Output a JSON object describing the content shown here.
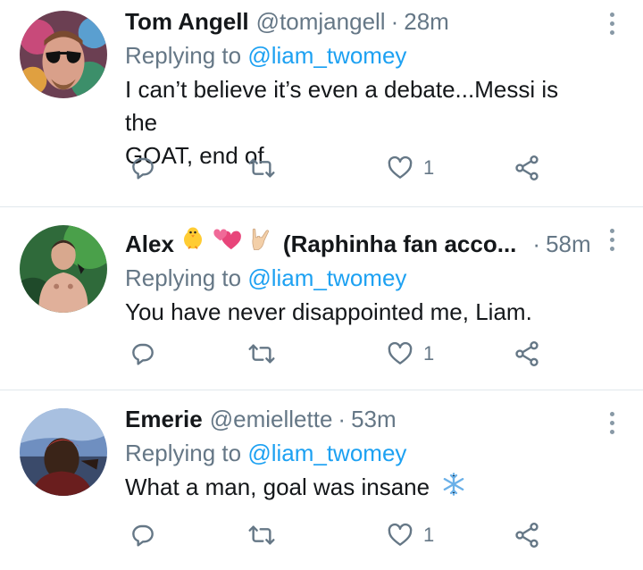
{
  "tweets": [
    {
      "name": "Tom Angell",
      "handle": "@tomjangell",
      "separator": "·",
      "time": "28m",
      "replying_prefix": "Replying to ",
      "replying_to": "@liam_twomey",
      "text_line1": "I can’t believe it’s even a debate...Messi is the",
      "text_line2": "GOAT, end of",
      "like_count": "1"
    },
    {
      "name": "Alex",
      "name_suffix": "(Raphinha fan acco...",
      "separator": "·",
      "time": "58m",
      "replying_prefix": "Replying to ",
      "replying_to": "@liam_twomey",
      "text": "You have never disappointed me, Liam.",
      "like_count": "1"
    },
    {
      "name": "Emerie",
      "handle": "@emiellette",
      "separator": "·",
      "time": "53m",
      "replying_prefix": "Replying to ",
      "replying_to": "@liam_twomey",
      "text": "What a man, goal was insane",
      "like_count": "1"
    }
  ],
  "icons": [
    "reply-icon",
    "retweet-icon",
    "like-icon",
    "share-icon",
    "more-options-icon"
  ],
  "colors": {
    "name": "#14171a",
    "secondary": "#657786",
    "mention": "#1da1f2",
    "divider": "#e1e8ed"
  }
}
